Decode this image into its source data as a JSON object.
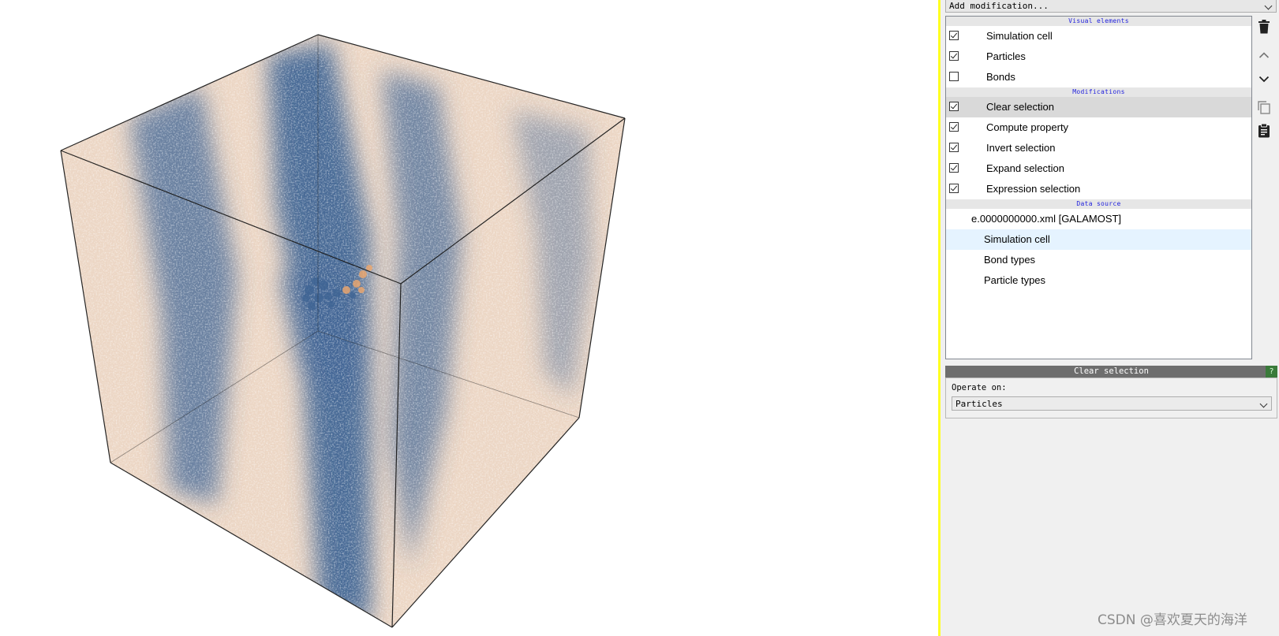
{
  "viewport": {
    "scene": "simulation-cell-particles",
    "particle_colors": {
      "type_a": "#3f6494",
      "type_b": "#f0a86c"
    },
    "cell_edge_color": "#1a1a1a"
  },
  "panel": {
    "add_modification": "Add modification...",
    "pipeline": {
      "visual_elements_header": "Visual elements",
      "visual_elements": [
        {
          "label": "Simulation cell",
          "checked": true
        },
        {
          "label": "Particles",
          "checked": true
        },
        {
          "label": "Bonds",
          "checked": false
        }
      ],
      "modifications_header": "Modifications",
      "modifications": [
        {
          "label": "Clear selection",
          "checked": true,
          "selected": true
        },
        {
          "label": "Compute property",
          "checked": true
        },
        {
          "label": "Invert selection",
          "checked": true
        },
        {
          "label": "Expand selection",
          "checked": true
        },
        {
          "label": "Expression selection",
          "checked": true
        }
      ],
      "data_source_header": "Data source",
      "data_source": {
        "file": "e.0000000000.xml [GALAMOST]",
        "children": [
          "Simulation cell",
          "Bond types",
          "Particle types"
        ]
      }
    },
    "tools": [
      "delete-icon",
      "move-up-icon",
      "move-down-icon",
      "copy-icon",
      "clipboard-icon"
    ],
    "editor": {
      "title": "Clear selection",
      "help": "?",
      "operate_on_label": "Operate on:",
      "operate_on_value": "Particles"
    }
  },
  "watermark": "CSDN @喜欢夏天的海洋"
}
